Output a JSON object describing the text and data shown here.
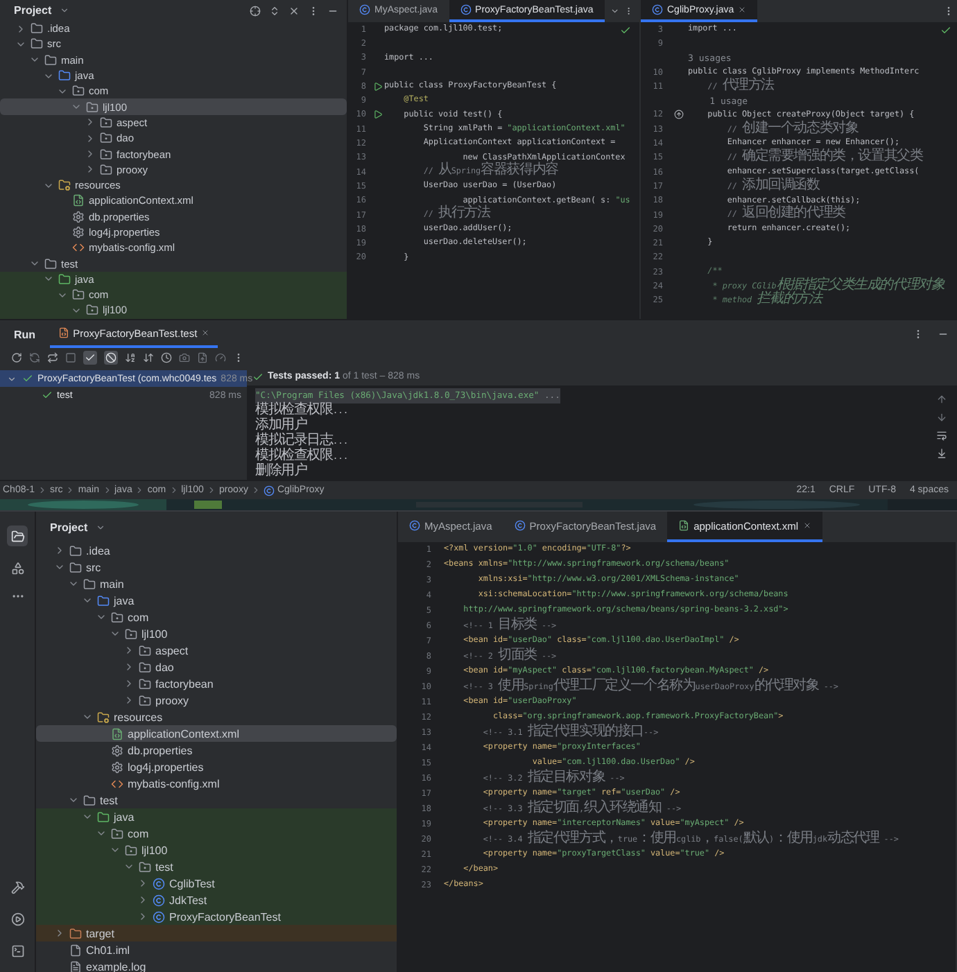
{
  "top": {
    "project_panel": {
      "title": "Project",
      "tree": [
        {
          "name": ".idea",
          "kind": "folder",
          "expanded": false,
          "selected": false
        },
        {
          "name": "src",
          "kind": "folder",
          "expanded": true,
          "selected": false,
          "children": [
            {
              "name": "main",
              "kind": "folder",
              "expanded": true,
              "selected": false,
              "children": [
                {
                  "name": "java",
                  "kind": "source-root",
                  "expanded": true,
                  "selected": false,
                  "children": [
                    {
                      "name": "com",
                      "kind": "package",
                      "expanded": true,
                      "selected": false,
                      "children": [
                        {
                          "name": "ljl100",
                          "kind": "package",
                          "expanded": true,
                          "selected": true,
                          "children": [
                            {
                              "name": "aspect",
                              "kind": "package",
                              "expanded": false,
                              "selected": false
                            },
                            {
                              "name": "dao",
                              "kind": "package",
                              "expanded": false,
                              "selected": false
                            },
                            {
                              "name": "factorybean",
                              "kind": "package",
                              "expanded": false,
                              "selected": false
                            },
                            {
                              "name": "prooxy",
                              "kind": "package",
                              "expanded": false,
                              "selected": false
                            }
                          ]
                        }
                      ]
                    }
                  ]
                },
                {
                  "name": "resources",
                  "kind": "resources",
                  "expanded": true,
                  "selected": false,
                  "children": [
                    {
                      "name": "applicationContext.xml",
                      "kind": "spring-xml",
                      "selected": false
                    },
                    {
                      "name": "db.properties",
                      "kind": "properties",
                      "selected": false
                    },
                    {
                      "name": "log4j.properties",
                      "kind": "properties",
                      "selected": false
                    },
                    {
                      "name": "mybatis-config.xml",
                      "kind": "xml",
                      "selected": false
                    }
                  ]
                }
              ]
            },
            {
              "name": "test",
              "kind": "folder",
              "expanded": true,
              "selected": false,
              "children": [
                {
                  "name": "java",
                  "kind": "test-root",
                  "expanded": true,
                  "selected": false,
                  "children": [
                    {
                      "name": "com",
                      "kind": "package",
                      "expanded": true,
                      "selected": false,
                      "children": [
                        {
                          "name": "ljl100",
                          "kind": "package",
                          "expanded": true,
                          "selected": false
                        }
                      ]
                    }
                  ]
                }
              ]
            }
          ]
        }
      ]
    },
    "editors": [
      {
        "tabs": [
          {
            "label": "MyAspect.java",
            "kind": "class",
            "selected": false
          },
          {
            "label": "ProxyFactoryBeanTest.java",
            "kind": "class",
            "selected": true
          }
        ],
        "lines": [
          {
            "n": "1",
            "text": "package com.ljl100.test;",
            "kind": "code"
          },
          {
            "n": "2",
            "kind": "code"
          },
          {
            "n": "3",
            "text": "import ...",
            "kind": "code"
          },
          {
            "n": "7",
            "kind": "code"
          },
          {
            "n": "8",
            "text": "public class ProxyFactoryBeanTest {",
            "kind": "code",
            "marker": {
              "kind": "run"
            }
          },
          {
            "n": "9",
            "text": "    @Test",
            "kind": "annotation"
          },
          {
            "n": "10",
            "text": "    public void test() {",
            "kind": "code",
            "marker": {
              "kind": "run"
            }
          },
          {
            "n": "11",
            "text": "        String xmlPath = \"applicationContext.xml\"",
            "kind": "code"
          },
          {
            "n": "12",
            "text": "        ApplicationContext applicationContext =",
            "kind": "code"
          },
          {
            "n": "13",
            "text": "                new ClassPathXmlApplicationContex",
            "kind": "code"
          },
          {
            "n": "14",
            "text": "        // 从Spring容器获得内容",
            "kind": "comment"
          },
          {
            "n": "15",
            "text": "        UserDao userDao = (UserDao)",
            "kind": "code"
          },
          {
            "n": "16",
            "text": "                applicationContext.getBean( s: \"us",
            "kind": "code"
          },
          {
            "n": "17",
            "text": "        // 执行方法",
            "kind": "comment"
          },
          {
            "n": "18",
            "text": "        userDao.addUser();",
            "kind": "code"
          },
          {
            "n": "19",
            "text": "        userDao.deleteUser();",
            "kind": "code"
          },
          {
            "n": "20",
            "text": "    }",
            "kind": "code"
          }
        ]
      },
      {
        "tabs": [
          {
            "label": "CglibProxy.java",
            "kind": "class",
            "selected": true
          }
        ],
        "lines": [
          {
            "n": "3",
            "text": "import ...",
            "kind": "code"
          },
          {
            "n": "9",
            "kind": "code"
          },
          {
            "text": "3 usages",
            "kind": "hint"
          },
          {
            "n": "10",
            "text": "public class CglibProxy implements MethodInterc",
            "kind": "code"
          },
          {
            "n": "11",
            "text": "    // 代理方法",
            "kind": "comment"
          },
          {
            "text": "    1 usage",
            "kind": "hint"
          },
          {
            "n": "12",
            "text": "    public Object createProxy(Object target) {",
            "kind": "code",
            "marker": {
              "kind": "override"
            }
          },
          {
            "n": "13",
            "text": "        // 创建一个动态类对象",
            "kind": "comment"
          },
          {
            "n": "14",
            "text": "        Enhancer enhancer = new Enhancer();",
            "kind": "code"
          },
          {
            "n": "15",
            "text": "        // 确定需要增强的类，设置其父类",
            "kind": "comment"
          },
          {
            "n": "16",
            "text": "        enhancer.setSuperclass(target.getClass(",
            "kind": "code"
          },
          {
            "n": "17",
            "text": "        // 添加回调函数",
            "kind": "comment"
          },
          {
            "n": "18",
            "text": "        enhancer.setCallback(this);",
            "kind": "code"
          },
          {
            "n": "19",
            "text": "        // 返回创建的代理类",
            "kind": "comment"
          },
          {
            "n": "20",
            "text": "        return enhancer.create();",
            "kind": "code"
          },
          {
            "n": "21",
            "text": "    }",
            "kind": "code"
          },
          {
            "n": "22",
            "kind": "code"
          },
          {
            "n": "23",
            "text": "    /**",
            "kind": "doc"
          },
          {
            "n": "24",
            "text": "     * proxy CGlib根据指定父类生成的代理对象",
            "kind": "doc"
          },
          {
            "n": "25",
            "text": "     * method 拦截的方法",
            "kind": "doc"
          }
        ]
      }
    ]
  },
  "run_panel": {
    "title": "Run",
    "tab": {
      "label": "ProxyFactoryBeanTest.test",
      "selected": true
    },
    "toggles": [
      {
        "kind": "passed",
        "on": true
      },
      {
        "kind": "ignored",
        "on": true
      }
    ],
    "tests": [
      {
        "name": "ProxyFactoryBeanTest (com.whc0049.tes",
        "time": "828 ms",
        "passed": true,
        "selected": true,
        "expanded": true,
        "children": [
          {
            "name": "test",
            "time": "828 ms",
            "passed": true,
            "selected": false
          }
        ]
      }
    ],
    "summary": "**Tests passed: 1** of 1 test – 828 ms",
    "console": [
      {
        "text": "\"C:\\Program Files (x86)\\Java\\jdk1.8.0_73\\bin\\java.exe\" ...",
        "kind": "command"
      },
      {
        "text": "模拟检查权限...",
        "kind": "output"
      },
      {
        "text": "添加用户",
        "kind": "output"
      },
      {
        "text": "模拟记录日志...",
        "kind": "output"
      },
      {
        "text": "模拟检查权限...",
        "kind": "output"
      },
      {
        "text": "删除用户",
        "kind": "output"
      }
    ]
  },
  "status_bar": {
    "breadcrumbs": [
      {
        "label": "Ch08-1",
        "kind": "folder"
      },
      {
        "label": "src",
        "kind": "folder"
      },
      {
        "label": "main",
        "kind": "folder"
      },
      {
        "label": "java",
        "kind": "folder"
      },
      {
        "label": "com",
        "kind": "folder"
      },
      {
        "label": "ljl100",
        "kind": "folder"
      },
      {
        "label": "prooxy",
        "kind": "folder"
      },
      {
        "label": "CglibProxy",
        "kind": "class"
      }
    ],
    "items": [
      "22:1",
      "CRLF",
      "UTF-8",
      "4 spaces"
    ]
  },
  "bottom": {
    "project_panel": {
      "title": "Project",
      "tree": [
        {
          "name": ".idea",
          "kind": "folder",
          "expanded": false,
          "selected": false
        },
        {
          "name": "src",
          "kind": "folder",
          "expanded": true,
          "selected": false,
          "children": [
            {
              "name": "main",
              "kind": "folder",
              "expanded": true,
              "selected": false,
              "children": [
                {
                  "name": "java",
                  "kind": "source-root",
                  "expanded": true,
                  "selected": false,
                  "children": [
                    {
                      "name": "com",
                      "kind": "package",
                      "expanded": true,
                      "selected": false,
                      "children": [
                        {
                          "name": "ljl100",
                          "kind": "package",
                          "expanded": true,
                          "selected": false,
                          "children": [
                            {
                              "name": "aspect",
                              "kind": "package",
                              "expanded": false,
                              "selected": false
                            },
                            {
                              "name": "dao",
                              "kind": "package",
                              "expanded": false,
                              "selected": false
                            },
                            {
                              "name": "factorybean",
                              "kind": "package",
                              "expanded": false,
                              "selected": false
                            },
                            {
                              "name": "prooxy",
                              "kind": "package",
                              "expanded": false,
                              "selected": false
                            }
                          ]
                        }
                      ]
                    }
                  ]
                },
                {
                  "name": "resources",
                  "kind": "resources",
                  "expanded": true,
                  "selected": false,
                  "children": [
                    {
                      "name": "applicationContext.xml",
                      "kind": "spring-xml",
                      "selected": true
                    },
                    {
                      "name": "db.properties",
                      "kind": "properties",
                      "selected": false
                    },
                    {
                      "name": "log4j.properties",
                      "kind": "properties",
                      "selected": false
                    },
                    {
                      "name": "mybatis-config.xml",
                      "kind": "xml",
                      "selected": false
                    }
                  ]
                }
              ]
            },
            {
              "name": "test",
              "kind": "folder",
              "expanded": true,
              "selected": false,
              "children": [
                {
                  "name": "java",
                  "kind": "test-root",
                  "expanded": true,
                  "selected": false,
                  "children": [
                    {
                      "name": "com",
                      "kind": "package",
                      "expanded": true,
                      "selected": false,
                      "children": [
                        {
                          "name": "ljl100",
                          "kind": "package",
                          "expanded": true,
                          "selected": false,
                          "children": [
                            {
                              "name": "test",
                              "kind": "package",
                              "expanded": true,
                              "selected": false,
                              "children": [
                                {
                                  "name": "CglibTest",
                                  "kind": "class",
                                  "expanded": false,
                                  "selected": false
                                },
                                {
                                  "name": "JdkTest",
                                  "kind": "class",
                                  "expanded": false,
                                  "selected": false
                                },
                                {
                                  "name": "ProxyFactoryBeanTest",
                                  "kind": "class",
                                  "expanded": false,
                                  "selected": false
                                }
                              ]
                            }
                          ]
                        }
                      ]
                    }
                  ]
                }
              ]
            }
          ]
        },
        {
          "name": "target",
          "kind": "excluded",
          "expanded": false,
          "selected": false
        },
        {
          "name": "Ch01.iml",
          "kind": "iml",
          "selected": false
        },
        {
          "name": "example.log",
          "kind": "log",
          "selected": false
        }
      ]
    },
    "editor": {
      "tabs": [
        {
          "label": "MyAspect.java",
          "kind": "class",
          "selected": false
        },
        {
          "label": "ProxyFactoryBeanTest.java",
          "kind": "class",
          "selected": false
        },
        {
          "label": "applicationContext.xml",
          "kind": "spring-xml",
          "selected": true
        }
      ],
      "lines": [
        {
          "n": "1",
          "text": "<?xml version=\"1.0\" encoding=\"UTF-8\"?>",
          "kind": "markup"
        },
        {
          "n": "2",
          "text": "<beans xmlns=\"http://www.springframework.org/schema/beans\"",
          "kind": "markup"
        },
        {
          "n": "3",
          "text": "       xmlns:xsi=\"http://www.w3.org/2001/XMLSchema-instance\"",
          "kind": "markup"
        },
        {
          "n": "4",
          "text": "       xsi:schemaLocation=\"http://www.springframework.org/schema/beans",
          "kind": "markup"
        },
        {
          "n": "5",
          "text": "    http://www.springframework.org/schema/beans/spring-beans-3.2.xsd\">",
          "kind": "url"
        },
        {
          "n": "6",
          "text": "    <!-- 1 目标类 -->",
          "kind": "comment"
        },
        {
          "n": "7",
          "text": "    <bean id=\"userDao\" class=\"com.ljl100.dao.UserDaoImpl\" />",
          "kind": "markup"
        },
        {
          "n": "8",
          "text": "    <!-- 2 切面类 -->",
          "kind": "comment"
        },
        {
          "n": "9",
          "text": "    <bean id=\"myAspect\" class=\"com.ljl100.factorybean.MyAspect\" />",
          "kind": "markup"
        },
        {
          "n": "10",
          "text": "    <!-- 3 使用Spring代理工厂定义一个名称为userDaoProxy的代理对象 -->",
          "kind": "comment"
        },
        {
          "n": "11",
          "text": "    <bean id=\"userDaoProxy\"",
          "kind": "markup"
        },
        {
          "n": "12",
          "text": "          class=\"org.springframework.aop.framework.ProxyFactoryBean\">",
          "kind": "markup"
        },
        {
          "n": "13",
          "text": "        <!-- 3.1 指定代理实现的接口-->",
          "kind": "comment"
        },
        {
          "n": "14",
          "text": "        <property name=\"proxyInterfaces\"",
          "kind": "markup"
        },
        {
          "n": "15",
          "text": "                  value=\"com.ljl100.dao.UserDao\" />",
          "kind": "markup"
        },
        {
          "n": "16",
          "text": "        <!-- 3.2 指定目标对象 -->",
          "kind": "comment"
        },
        {
          "n": "17",
          "text": "        <property name=\"target\" ref=\"userDao\" />",
          "kind": "markup"
        },
        {
          "n": "18",
          "text": "        <!-- 3.3 指定切面,织入环绕通知 -->",
          "kind": "comment"
        },
        {
          "n": "19",
          "text": "        <property name=\"interceptorNames\" value=\"myAspect\" />",
          "kind": "markup"
        },
        {
          "n": "20",
          "text": "        <!-- 3.4 指定代理方式，true：使用cglib，false(默认)：使用jdk动态代理 -->",
          "kind": "comment"
        },
        {
          "n": "21",
          "text": "        <property name=\"proxyTargetClass\" value=\"true\" />",
          "kind": "markup"
        },
        {
          "n": "22",
          "text": "    </bean>",
          "kind": "markup"
        },
        {
          "n": "23",
          "text": "</beans>",
          "kind": "markup"
        }
      ]
    }
  }
}
